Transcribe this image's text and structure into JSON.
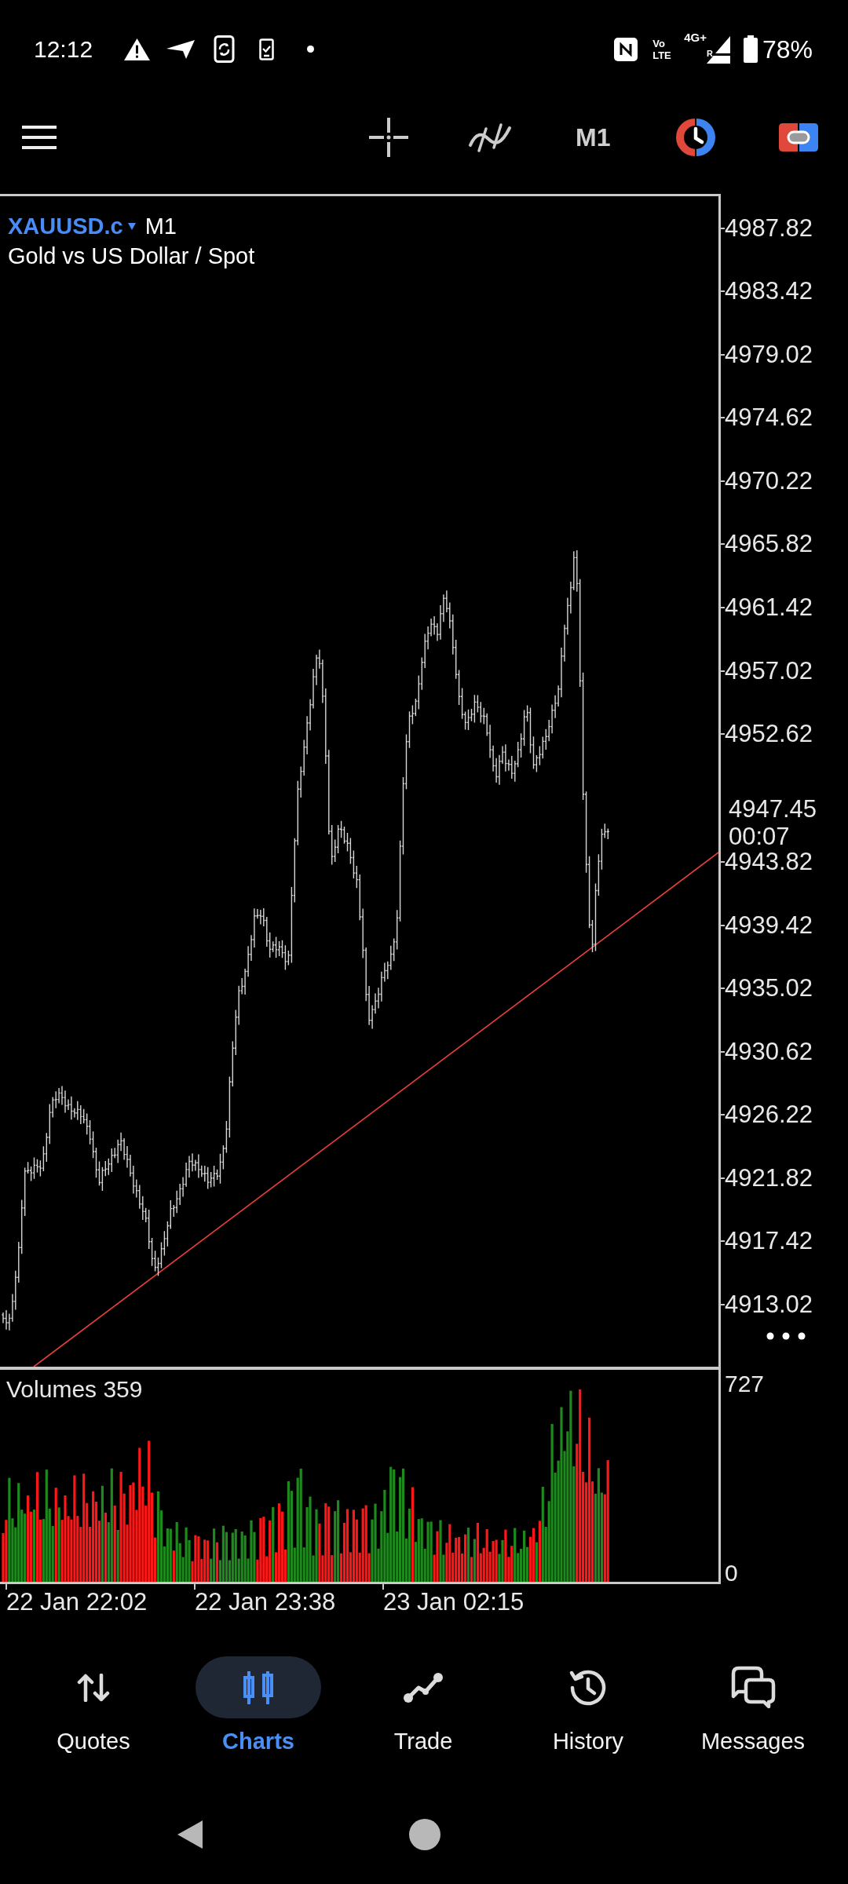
{
  "status_bar": {
    "time": "12:12",
    "volte": "Vo LTE",
    "network": "4G+",
    "roaming": "R",
    "battery": "78%"
  },
  "toolbar": {
    "timeframe": "M1"
  },
  "chart": {
    "symbol": "XAUUSD.c",
    "timeframe": "M1",
    "description": "Gold vs US Dollar / Spot",
    "price_labels_upper": [
      "4987.82",
      "4983.42",
      "4979.02",
      "4974.62",
      "4970.22",
      "4965.82",
      "4961.42",
      "4957.02",
      "4952.62"
    ],
    "current_price": "4947.45",
    "bar_countdown": "00:07",
    "price_labels_lower": [
      "4943.82",
      "4939.42",
      "4935.02",
      "4930.62",
      "4926.22",
      "4921.82",
      "4917.42",
      "4913.02"
    ]
  },
  "volume_pane": {
    "title": "Volumes 359",
    "scale_max": "727",
    "scale_min": "0"
  },
  "time_axis": [
    "22 Jan 22:02",
    "22 Jan 23:38",
    "23 Jan 02:15"
  ],
  "bottom_nav": {
    "items": [
      {
        "label": "Quotes",
        "selected": false
      },
      {
        "label": "Charts",
        "selected": true
      },
      {
        "label": "Trade",
        "selected": false
      },
      {
        "label": "History",
        "selected": false
      },
      {
        "label": "Messages",
        "selected": false
      }
    ]
  }
}
